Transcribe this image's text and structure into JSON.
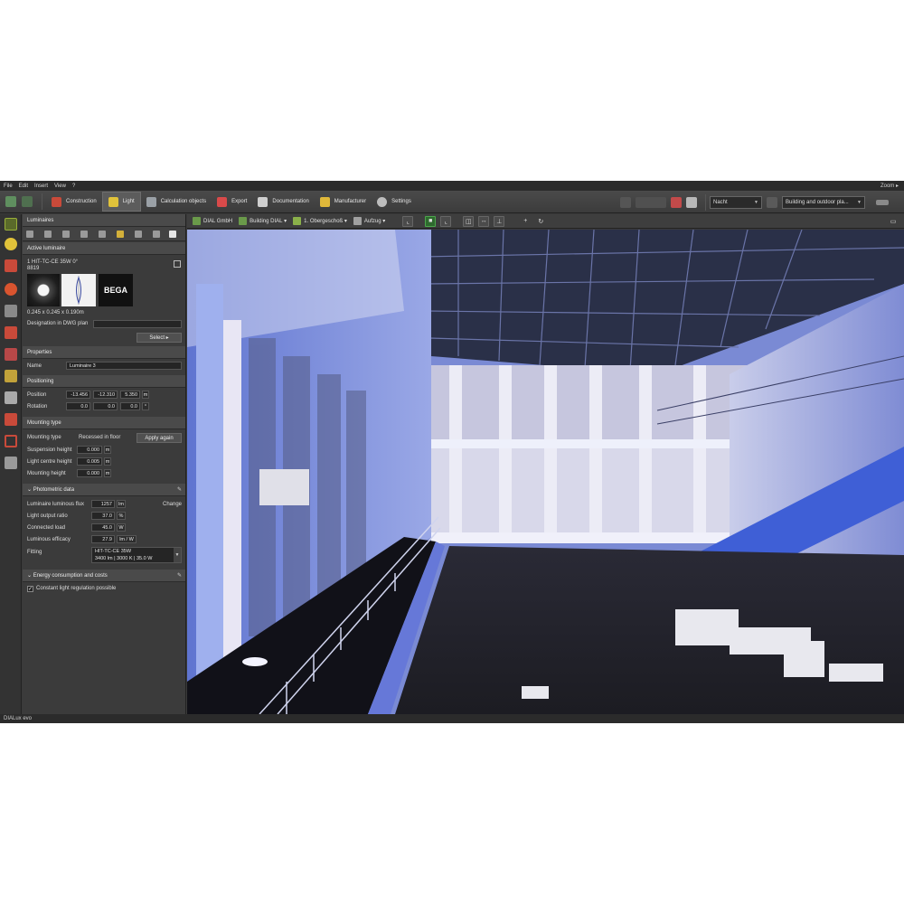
{
  "menu": [
    "File",
    "Edit",
    "Insert",
    "View",
    "?"
  ],
  "zoom_label": "Zoom",
  "ribbon": {
    "tabs": [
      {
        "label": "Construction",
        "icon": "construction-icon",
        "color": "#c94a3a"
      },
      {
        "label": "Light",
        "icon": "lamp-icon",
        "color": "#e0c23a",
        "active": true
      },
      {
        "label": "Calculation objects",
        "icon": "calculation-icon",
        "color": "#9aa0a6"
      },
      {
        "label": "Export",
        "icon": "export-icon",
        "color": "#d94a4a"
      },
      {
        "label": "Documentation",
        "icon": "documentation-icon",
        "color": "#cfcfcf"
      },
      {
        "label": "Manufacturer",
        "icon": "manufacturer-icon",
        "color": "#e0b83a"
      },
      {
        "label": "Settings",
        "icon": "gear-icon",
        "color": "#bdbdbd"
      }
    ],
    "scene_select": "Nacht",
    "view_select": "Building and outdoor pla..."
  },
  "panel": {
    "title": "Luminaires",
    "active_section": "Active luminaire",
    "luminaire_name": "1 HIT-TC-CE 35W 0°",
    "luminaire_code": "8819",
    "brand": "BEGA",
    "dimensions": "0.245 x 0.245 x 0.190m",
    "designation_label": "Designation in DWG plan",
    "designation_value": "",
    "select_button": "Select",
    "properties_section": "Properties",
    "name_label": "Name",
    "name_value": "Luminaire 3",
    "positioning_section": "Positioning",
    "position_label": "Position",
    "position_values": [
      "-13.456",
      "-12.310",
      "5.350"
    ],
    "position_unit": "m",
    "rotation_label": "Rotation",
    "rotation_values": [
      "0.0",
      "0.0",
      "0.0"
    ],
    "rotation_unit": "°",
    "mounting_section": "Mounting type",
    "mounting_type_label": "Mounting type",
    "mounting_type_value": "Recessed in floor",
    "apply_button": "Apply again",
    "suspension_label": "Suspension height",
    "suspension_value": "0.000",
    "light_centre_label": "Light centre height",
    "light_centre_value": "0.005",
    "mounting_height_label": "Mounting height",
    "mounting_height_value": "0.000",
    "unit_m": "m",
    "photometric_section": "Photometric data",
    "flux_label": "Luminaire luminous flux",
    "flux_value": "1257",
    "flux_unit": "lm",
    "change_button": "Change",
    "lor_label": "Light output ratio",
    "lor_value": "37.0",
    "lor_unit": "%",
    "load_label": "Connected load",
    "load_value": "45.0",
    "load_unit": "W",
    "efficacy_label": "Luminous efficacy",
    "efficacy_value": "27.9",
    "efficacy_unit": "lm / W",
    "fitting_label": "Fitting",
    "fitting_line1": "HIT-TC-CE 35W",
    "fitting_line2": "3400 lm | 3000 K | 35.0 W",
    "energy_section": "Energy consumption and costs",
    "constant_light_label": "Constant light regulation possible",
    "constant_light_checked": true
  },
  "breadcrumb": {
    "company": "DIAL GmbH",
    "building": "Building DIAL",
    "floor": "1. Obergeschoß",
    "room": "Aufzug"
  },
  "status": {
    "brand": "DIALux evo"
  }
}
